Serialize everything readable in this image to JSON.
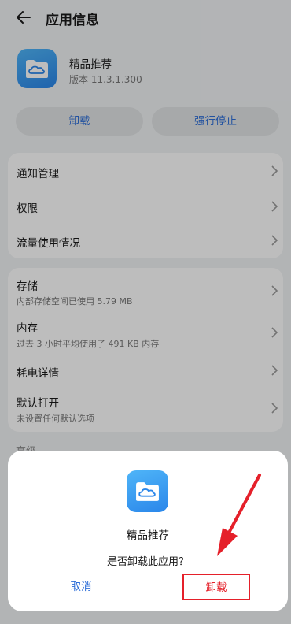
{
  "header": {
    "title": "应用信息",
    "back_icon": "back-arrow-icon"
  },
  "app": {
    "name": "精品推荐",
    "version": "版本 11.3.1.300",
    "icon": "cloud-folder-icon"
  },
  "actions": {
    "uninstall_label": "卸载",
    "force_stop_label": "强行停止",
    "accent": "#2f6fd8"
  },
  "settings_group_1": [
    {
      "title": "通知管理"
    },
    {
      "title": "权限"
    },
    {
      "title": "流量使用情况"
    }
  ],
  "settings_group_2": [
    {
      "title": "存储",
      "subtitle": "内部存储空间已使用 5.79 MB"
    },
    {
      "title": "内存",
      "subtitle": "过去 3 小时平均使用了 491 KB 内存"
    },
    {
      "title": "耗电详情"
    },
    {
      "title": "默认打开",
      "subtitle": "未设置任何默认选项"
    }
  ],
  "peek_label": "高级",
  "dialog": {
    "app_name": "精品推荐",
    "message": "是否卸载此应用？",
    "cancel_label": "取消",
    "confirm_label": "卸载",
    "highlight_color": "#e5202a"
  }
}
